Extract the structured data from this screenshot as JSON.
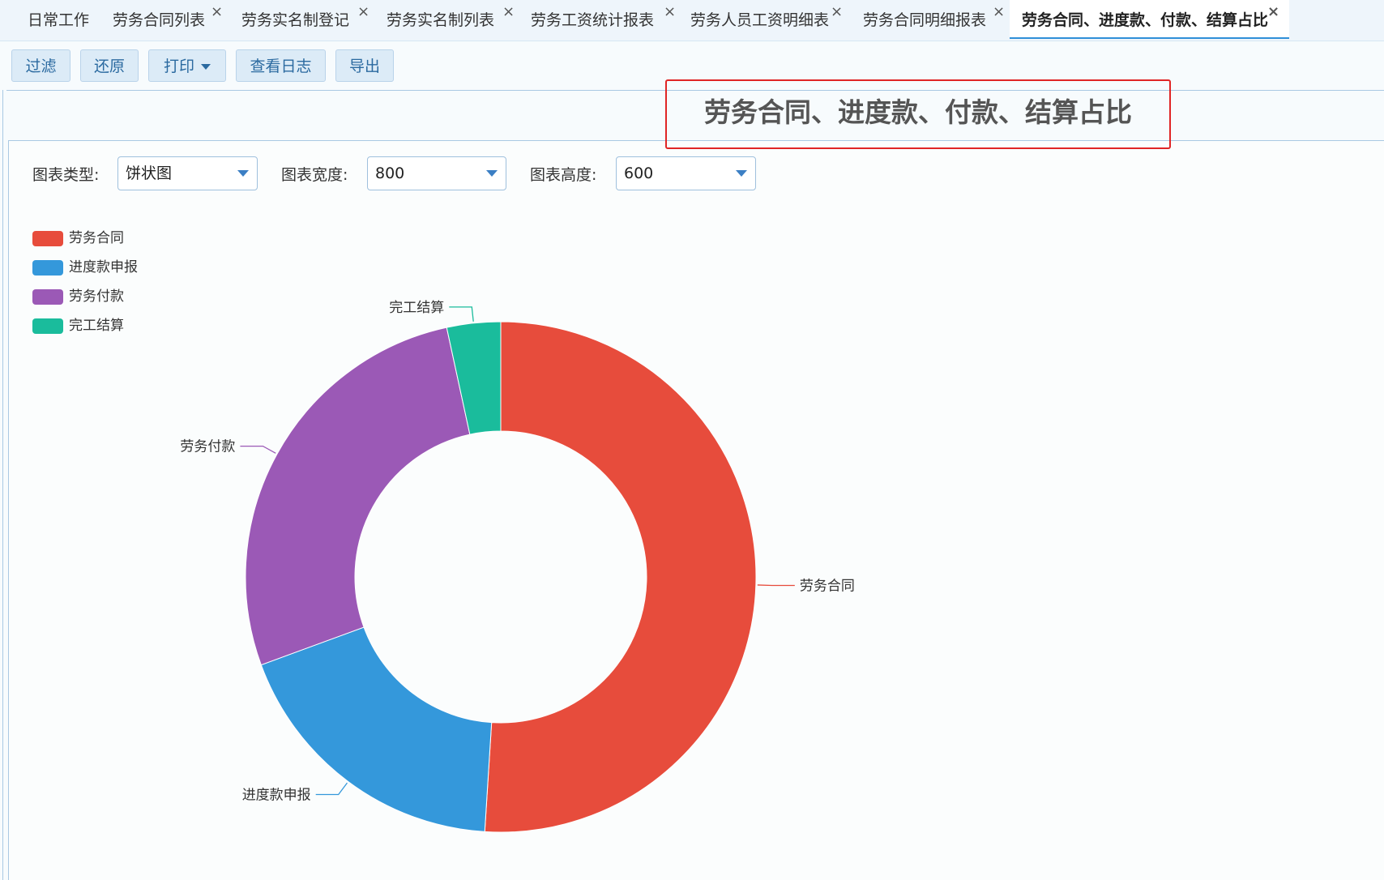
{
  "tabs": [
    {
      "label": "日常工作",
      "closable": false
    },
    {
      "label": "劳务合同列表",
      "closable": true
    },
    {
      "label": "劳务实名制登记",
      "closable": true
    },
    {
      "label": "劳务实名制列表",
      "closable": true
    },
    {
      "label": "劳务工资统计报表",
      "closable": true
    },
    {
      "label": "劳务人员工资明细表",
      "closable": true
    },
    {
      "label": "劳务合同明细报表",
      "closable": true
    },
    {
      "label": "劳务合同、进度款、付款、结算占比",
      "closable": true,
      "active": true
    }
  ],
  "tab_close_glyph": "×",
  "toolbar": {
    "filter": "过滤",
    "restore": "还原",
    "print": "打印",
    "view_log": "查看日志",
    "export": "导出"
  },
  "page_title": "劳务合同、进度款、付款、结算占比",
  "controls": {
    "chart_type_label": "图表类型:",
    "chart_type_value": "饼状图",
    "chart_width_label": "图表宽度:",
    "chart_width_value": "800",
    "chart_height_label": "图表高度:",
    "chart_height_value": "600"
  },
  "colors": {
    "labor_contract": "#e74c3c",
    "progress_payment": "#3498db",
    "labor_payment": "#9b59b6",
    "completion_settlement": "#1abc9c"
  },
  "chart_data": {
    "type": "pie",
    "donut": true,
    "legend_position": "top-left",
    "series": [
      {
        "name": "劳务合同",
        "value": 51.0,
        "color": "#e74c3c"
      },
      {
        "name": "进度款申报",
        "value": 18.4,
        "color": "#3498db"
      },
      {
        "name": "劳务付款",
        "value": 27.2,
        "color": "#9b59b6"
      },
      {
        "name": "完工结算",
        "value": 3.4,
        "color": "#1abc9c"
      }
    ]
  }
}
